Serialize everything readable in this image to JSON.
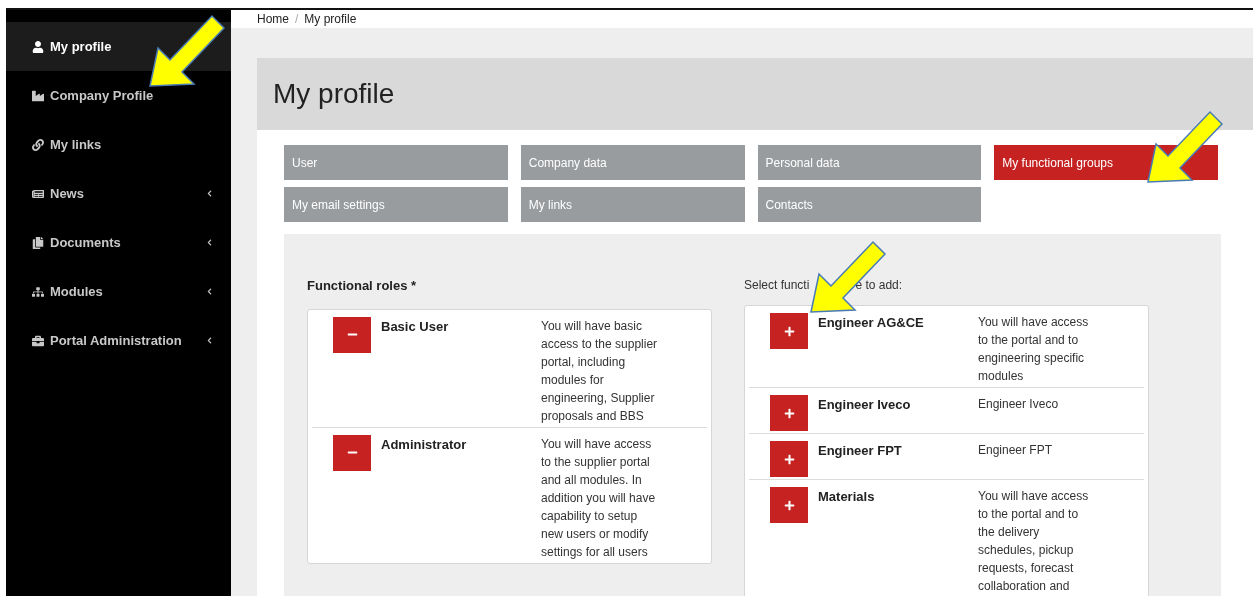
{
  "sidebar": {
    "items": [
      {
        "label": "My profile",
        "selected": true,
        "has_submenu": false
      },
      {
        "label": "Company Profile",
        "selected": false,
        "has_submenu": false
      },
      {
        "label": "My links",
        "selected": false,
        "has_submenu": false
      },
      {
        "label": "News",
        "selected": false,
        "has_submenu": true
      },
      {
        "label": "Documents",
        "selected": false,
        "has_submenu": true
      },
      {
        "label": "Modules",
        "selected": false,
        "has_submenu": true
      },
      {
        "label": "Portal Administration",
        "selected": false,
        "has_submenu": true
      }
    ]
  },
  "breadcrumb": {
    "separator": "/",
    "items": [
      "Home",
      "My profile"
    ]
  },
  "page_title": "My profile",
  "tabs": [
    {
      "label": "User",
      "selected": false
    },
    {
      "label": "Company data",
      "selected": false
    },
    {
      "label": "Personal data",
      "selected": false
    },
    {
      "label": "My functional groups",
      "selected": true
    },
    {
      "label": "My email settings",
      "selected": false
    },
    {
      "label": "My links",
      "selected": false
    },
    {
      "label": "Contacts",
      "selected": false
    }
  ],
  "assigned_roles": {
    "heading": "Functional roles *",
    "roles": [
      {
        "name": "Basic User",
        "description": "You will have basic access to the supplier portal, including modules for engineering, Supplier proposals and BBS"
      },
      {
        "name": "Administrator",
        "description": "You will have access to the supplier portal and all modules. In addition you will have capability to setup new users or modify settings for all users"
      }
    ]
  },
  "available_roles": {
    "heading_parts": [
      "Select functi",
      "e to add:"
    ],
    "roles": [
      {
        "name": "Engineer AG&CE",
        "description": "You will have access to the portal and to engineering specific modules"
      },
      {
        "name": "Engineer Iveco",
        "description": "Engineer Iveco"
      },
      {
        "name": "Engineer FPT",
        "description": "Engineer FPT"
      },
      {
        "name": "Materials",
        "description": "You will have access to the portal and to the delivery schedules, pickup requests, forecast collaboration and"
      }
    ]
  }
}
